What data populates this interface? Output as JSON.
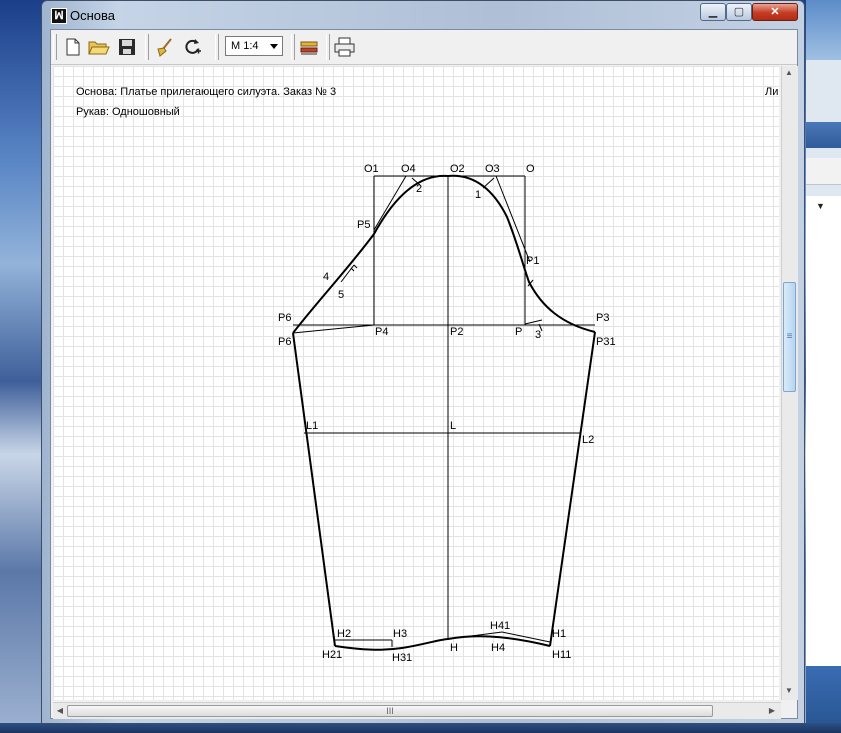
{
  "window": {
    "title": "Основа",
    "icon": "app-logo-icon"
  },
  "toolbar": {
    "buttons": [
      "new-file-icon",
      "open-folder-icon",
      "save-icon",
      "broom-icon",
      "refresh-icon",
      "measure-icon",
      "print-icon"
    ],
    "scale_value": "М 1:4"
  },
  "header_info": {
    "base_label": "Основа:",
    "base_value": "Платье прилегающего силуэта. Заказ № 3",
    "sleeve_label": "Рукав:",
    "sleeve_value": "Одношовный",
    "right_cut": "Ли"
  },
  "pattern": {
    "labels": [
      "O1",
      "O4",
      "O2",
      "O3",
      "O",
      "2",
      "1",
      "P5",
      "P1",
      "4",
      "5",
      "P6",
      "P3",
      "P4",
      "P2",
      "P",
      "3",
      "P6",
      "P31",
      "L1",
      "L",
      "L2",
      "H2",
      "H3",
      "H41",
      "H1",
      "H21",
      "H31",
      "H",
      "H4",
      "H11"
    ]
  },
  "scrollbar": {
    "grip": "≡",
    "h_grip": "III"
  }
}
